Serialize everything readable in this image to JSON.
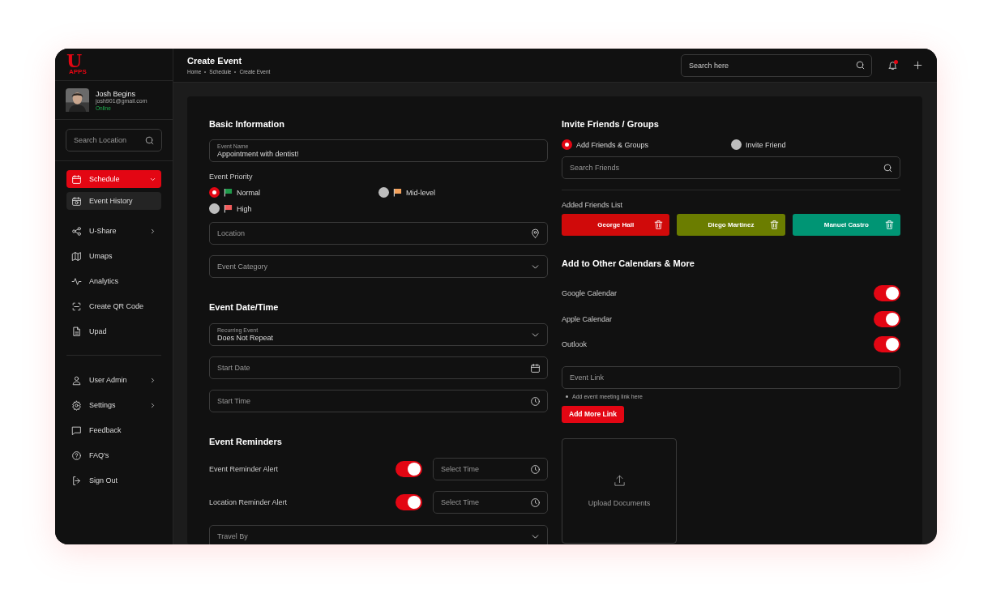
{
  "logo": {
    "letter": "U",
    "caption": "APPS"
  },
  "user": {
    "name": "Josh Begins",
    "email": "josh901@gmail.com",
    "status": "Online",
    "online": true
  },
  "sidebar": {
    "search": {
      "placeholder": "Search Location"
    },
    "items": [
      {
        "label": "Schedule",
        "selected": true,
        "expandable": true,
        "expanded": true,
        "children": [
          {
            "label": "Event History",
            "selected": true
          }
        ]
      },
      {
        "label": "U-Share",
        "selected": false,
        "expandable": true,
        "expanded": false
      },
      {
        "label": "Umaps",
        "selected": false,
        "expandable": false
      },
      {
        "label": "Analytics",
        "selected": false,
        "expandable": false
      },
      {
        "label": "Create QR Code",
        "selected": false,
        "expandable": false
      },
      {
        "label": "Upad",
        "selected": false,
        "expandable": false
      }
    ],
    "bottom_items": [
      {
        "label": "User Admin",
        "selected": false,
        "expandable": true
      },
      {
        "label": "Settings",
        "selected": false,
        "expandable": true
      },
      {
        "label": "Feedback",
        "selected": false,
        "expandable": false
      },
      {
        "label": "FAQ's",
        "selected": false,
        "expandable": false
      },
      {
        "label": "Sign Out",
        "selected": false,
        "expandable": false
      }
    ]
  },
  "header": {
    "title": "Create Event",
    "breadcrumbs": [
      "Home",
      "Schedule",
      "Create Event"
    ],
    "search": {
      "placeholder": "Search here"
    },
    "has_notifications": true
  },
  "basic_information": {
    "title": "Basic Information",
    "event_name": {
      "label": "Event Name",
      "value": "Appointment with dentist!"
    },
    "priority": {
      "label": "Event Priority",
      "options": [
        {
          "label": "Normal",
          "color": "#1f9a4a",
          "selected": true
        },
        {
          "label": "Mid-level",
          "color": "#f4a25c",
          "selected": false
        },
        {
          "label": "High",
          "color": "#f25c5c",
          "selected": false
        }
      ]
    },
    "location": {
      "placeholder": "Location"
    },
    "category": {
      "placeholder": "Event Category"
    }
  },
  "date_time": {
    "title": "Event Date/Time",
    "recurring": {
      "label": "Recurring Event",
      "value": "Does Not Repeat"
    },
    "start_date": {
      "placeholder": "Start Date"
    },
    "start_time": {
      "placeholder": "Start Time"
    }
  },
  "reminders": {
    "title": "Event Reminders",
    "items": [
      {
        "label": "Event Reminder Alert",
        "on": true,
        "time": {
          "placeholder": "Select Time"
        }
      },
      {
        "label": "Location Reminder Alert",
        "on": true,
        "time": {
          "placeholder": "Select Time"
        }
      }
    ],
    "travel_by": {
      "placeholder": "Travel By"
    }
  },
  "invite": {
    "title": "Invite Friends / Groups",
    "modes": [
      {
        "label": "Add Friends & Groups",
        "selected": true
      },
      {
        "label": "Invite Friend",
        "selected": false
      }
    ],
    "search": {
      "placeholder": "Search Friends"
    },
    "added_label": "Added Friends List",
    "friends": [
      {
        "name": "George Hall",
        "color": "#d00a0a"
      },
      {
        "name": "Diego Martinez",
        "color": "#6b7d00"
      },
      {
        "name": "Manuel Castro",
        "color": "#009574"
      }
    ]
  },
  "calendars": {
    "title": "Add to Other Calendars & More",
    "items": [
      {
        "label": "Google Calendar",
        "on": true
      },
      {
        "label": "Apple Calendar",
        "on": true
      },
      {
        "label": "Outlook",
        "on": true
      }
    ]
  },
  "event_link": {
    "placeholder": "Event Link",
    "hint": "Add event meeting link here",
    "button": "Add More Link"
  },
  "upload": {
    "label": "Upload Documents"
  }
}
